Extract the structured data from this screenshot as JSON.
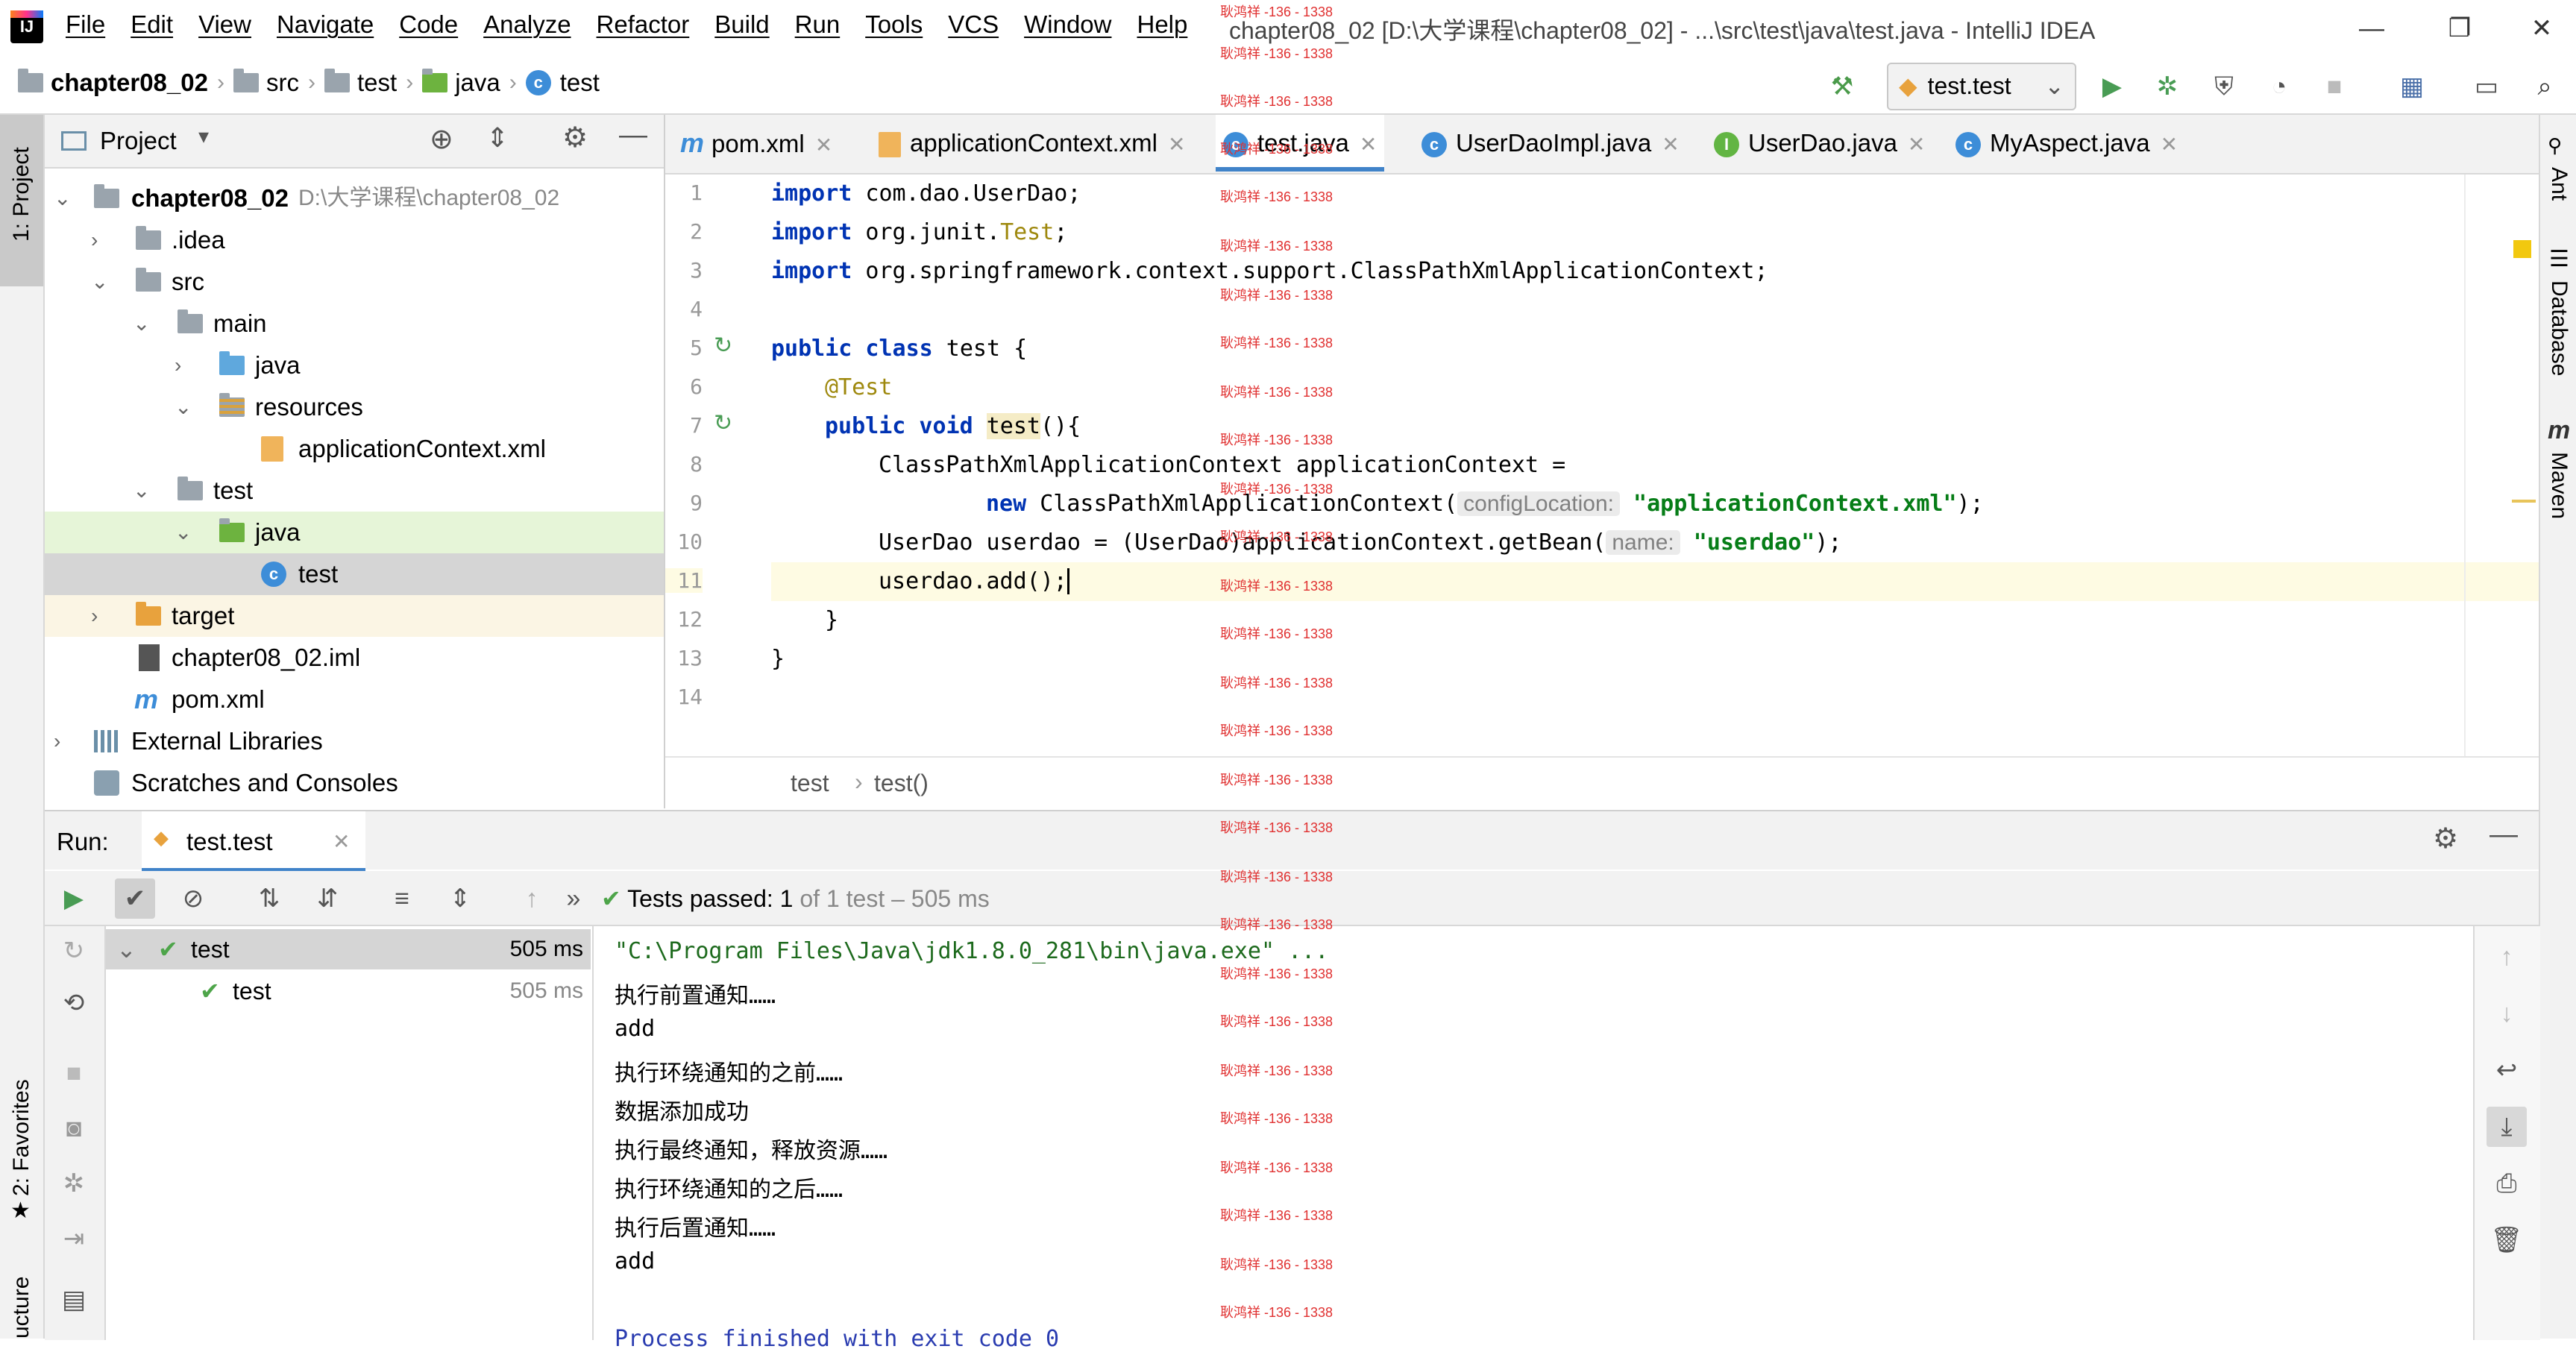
{
  "app": {
    "logo_text": "IJ",
    "menu": [
      "File",
      "Edit",
      "View",
      "Navigate",
      "Code",
      "Analyze",
      "Refactor",
      "Build",
      "Run",
      "Tools",
      "VCS",
      "Window",
      "Help"
    ],
    "window_title": "chapter08_02 [D:\\大学课程\\chapter08_02] - ...\\src\\test\\java\\test.java - IntelliJ IDEA",
    "window_controls": [
      "—",
      "❐",
      "✕"
    ]
  },
  "navbar": {
    "crumbs": [
      "chapter08_02",
      "src",
      "test",
      "java",
      "test"
    ],
    "run_config": "test.test"
  },
  "left_strip": {
    "project_tab": "1: Project",
    "favorites_tab": "2: Favorites",
    "structure_tab": "ucture"
  },
  "right_strip": {
    "ant": "Ant",
    "database": "Database",
    "maven": "Maven"
  },
  "project": {
    "title": "Project",
    "tree": [
      {
        "label": "chapter08_02",
        "path": "D:\\大学课程\\chapter08_02"
      },
      {
        "label": ".idea"
      },
      {
        "label": "src"
      },
      {
        "label": "main"
      },
      {
        "label": "java"
      },
      {
        "label": "resources"
      },
      {
        "label": "applicationContext.xml"
      },
      {
        "label": "test"
      },
      {
        "label": "java"
      },
      {
        "label": "test"
      },
      {
        "label": "target"
      },
      {
        "label": "chapter08_02.iml"
      },
      {
        "label": "pom.xml"
      },
      {
        "label": "External Libraries"
      },
      {
        "label": "Scratches and Consoles"
      }
    ]
  },
  "editor": {
    "tabs": [
      {
        "label": "pom.xml",
        "icon": "m"
      },
      {
        "label": "applicationContext.xml",
        "icon": "xml"
      },
      {
        "label": "test.java",
        "icon": "c"
      },
      {
        "label": "UserDaoImpl.java",
        "icon": "c"
      },
      {
        "label": "UserDao.java",
        "icon": "i"
      },
      {
        "label": "MyAspect.java",
        "icon": "c"
      }
    ],
    "line_numbers": [
      "1",
      "2",
      "3",
      "4",
      "5",
      "6",
      "7",
      "8",
      "9",
      "10",
      "11",
      "12",
      "13",
      "14"
    ],
    "code": {
      "l1_kw": "import",
      "l1_rest": " com.dao.UserDao;",
      "l2_kw": "import",
      "l2_a": " org.junit.",
      "l2_ann": "Test",
      "l2_end": ";",
      "l3_kw": "import",
      "l3_rest": " org.springframework.context.support.ClassPathXmlApplicationContext;",
      "l5_kw": "public class",
      "l5_rest": " test {",
      "l6_ann": "@Test",
      "l7_kw": "public void",
      "l7_sp": " ",
      "l7_meth": "test",
      "l7_rest": "(){",
      "l8": "ClassPathXmlApplicationContext applicationContext =",
      "l9_kw": "new",
      "l9_rest": " ClassPathXmlApplicationContext(",
      "l9_hint": "configLocation:",
      "l9_str": "\"applicationContext.xml\"",
      "l9_end": ");",
      "l10_a": "UserDao userdao = (UserDao)applicationContext.getBean(",
      "l10_hint": "name:",
      "l10_str": "\"userdao\"",
      "l10_end": ");",
      "l11": "userdao.add();",
      "l12": "}",
      "l13": "}"
    },
    "breadcrumb": [
      "test",
      "test()"
    ]
  },
  "run": {
    "label": "Run:",
    "tab": "test.test",
    "status_prefix": "Tests passed:",
    "status_count": "1",
    "status_rest": "of 1 test – 505 ms",
    "tests": [
      {
        "name": "test",
        "time": "505 ms"
      },
      {
        "name": "test",
        "time": "505 ms"
      }
    ],
    "console": [
      "\"C:\\Program Files\\Java\\jdk1.8.0_281\\bin\\java.exe\" ...",
      "执行前置通知……",
      "add",
      "执行环绕通知的之前……",
      "数据添加成功",
      "执行最终通知，释放资源……",
      "执行环绕通知的之后……",
      "执行后置通知……",
      "add",
      "",
      "Process finished with exit code 0"
    ]
  },
  "watermark": "耿鸿祥 -136 - 1338"
}
